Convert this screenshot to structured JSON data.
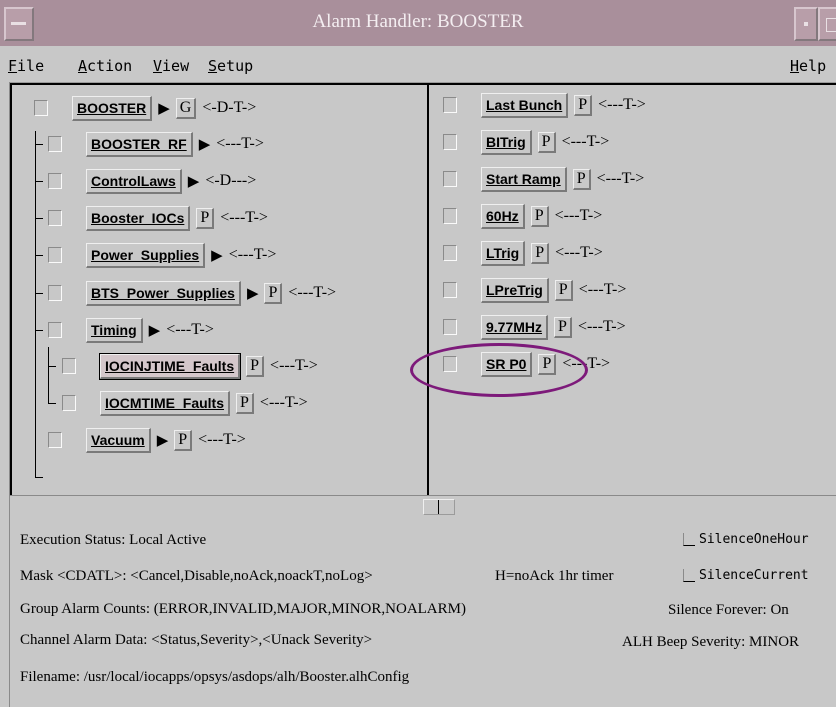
{
  "window": {
    "title": "Alarm Handler: BOOSTER"
  },
  "menu": {
    "file": {
      "u": "F",
      "rest": "ile"
    },
    "action": {
      "u": "A",
      "rest": "ction"
    },
    "view": {
      "u": "V",
      "rest": "iew"
    },
    "setup": {
      "u": "S",
      "rest": "etup"
    },
    "help": {
      "u": "H",
      "rest": "elp"
    }
  },
  "tree": {
    "root": {
      "name": "BOOSTER",
      "arrow": "▶",
      "flag": "G",
      "mask": "<-D-T->"
    },
    "items": [
      {
        "name": "BOOSTER_RF",
        "arrow": "▶",
        "flag": "",
        "mask": "<---T->"
      },
      {
        "name": "ControlLaws",
        "arrow": "▶",
        "flag": "",
        "mask": "<-D--->"
      },
      {
        "name": "Booster_IOCs",
        "arrow": "",
        "flag": "P",
        "mask": "<---T->"
      },
      {
        "name": "Power_Supplies",
        "arrow": "▶",
        "flag": "",
        "mask": "<---T->"
      },
      {
        "name": "BTS_Power_Supplies",
        "arrow": "▶",
        "flag": "P",
        "mask": "<---T->"
      },
      {
        "name": "Timing",
        "arrow": "▶",
        "flag": "",
        "mask": "<---T->"
      },
      {
        "name": "IOCINJTIME_Faults",
        "arrow": "",
        "flag": "P",
        "mask": "<---T->"
      },
      {
        "name": "IOCMTIME_Faults",
        "arrow": "",
        "flag": "P",
        "mask": "<---T->"
      },
      {
        "name": "Vacuum",
        "arrow": "▶",
        "flag": "P",
        "mask": "<---T->"
      }
    ]
  },
  "channels": [
    {
      "name": "Last Bunch",
      "flag": "P",
      "mask": "<---T->"
    },
    {
      "name": "BITrig",
      "flag": "P",
      "mask": "<---T->"
    },
    {
      "name": "Start Ramp",
      "flag": "P",
      "mask": "<---T->"
    },
    {
      "name": "60Hz",
      "flag": "P",
      "mask": "<---T->"
    },
    {
      "name": "LTrig",
      "flag": "P",
      "mask": "<---T->"
    },
    {
      "name": "LPreTrig",
      "flag": "P",
      "mask": "<---T->"
    },
    {
      "name": "9.77MHz",
      "flag": "P",
      "mask": "<---T->"
    },
    {
      "name": "SR P0",
      "flag": "P",
      "mask": "<---T->"
    }
  ],
  "status": {
    "execution": "Execution Status:  Local Active",
    "mask": "Mask <CDATL>:  <Cancel,Disable,noAck,noackT,noLog>",
    "mask_note": "H=noAck 1hr timer",
    "group_counts": "Group Alarm Counts:  (ERROR,INVALID,MAJOR,MINOR,NOALARM)",
    "channel_data": "Channel Alarm Data:  <Status,Severity>,<Unack Severity>",
    "filename": "Filename:   /usr/local/iocapps/opsys/asdops/alh/Booster.alhConfig",
    "silence_one_hour": "SilenceOneHour",
    "silence_current": "SilenceCurrent",
    "silence_forever": "Silence Forever:  On",
    "beep_severity": "ALH Beep Severity:  MINOR"
  },
  "annotation_color": "#7d1a7a"
}
